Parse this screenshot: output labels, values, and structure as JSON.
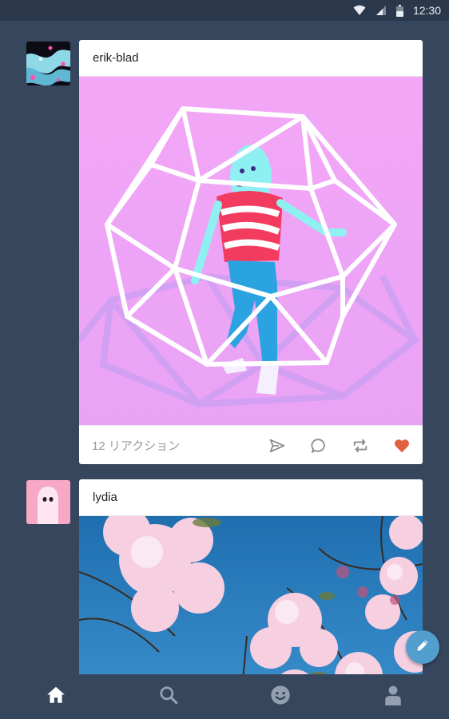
{
  "status_bar": {
    "time": "12:30",
    "icons": [
      "wifi-icon",
      "signal-icon",
      "battery-icon"
    ]
  },
  "posts": [
    {
      "blog": "erik-blad",
      "avatar": "abstract-avatar",
      "image": "illustration-figure-in-wireframe-polyhedron",
      "notes": "12 リアクション",
      "liked": true
    },
    {
      "blog": "lydia",
      "avatar": "ghost-avatar",
      "image": "photo-cherry-blossoms-blue-sky"
    }
  ],
  "post_actions": [
    "share-icon",
    "reply-icon",
    "reblog-icon",
    "heart-icon"
  ],
  "fab": {
    "icon": "pencil-icon"
  },
  "bottom_nav": [
    "home-icon",
    "search-icon",
    "activity-smiley-icon",
    "account-icon"
  ],
  "colors": {
    "background": "#36465d",
    "status_bar": "#2b384b",
    "accent_blue": "#529ecc",
    "heart_liked": "#e0603f",
    "icon_grey": "#8c8c8c"
  }
}
